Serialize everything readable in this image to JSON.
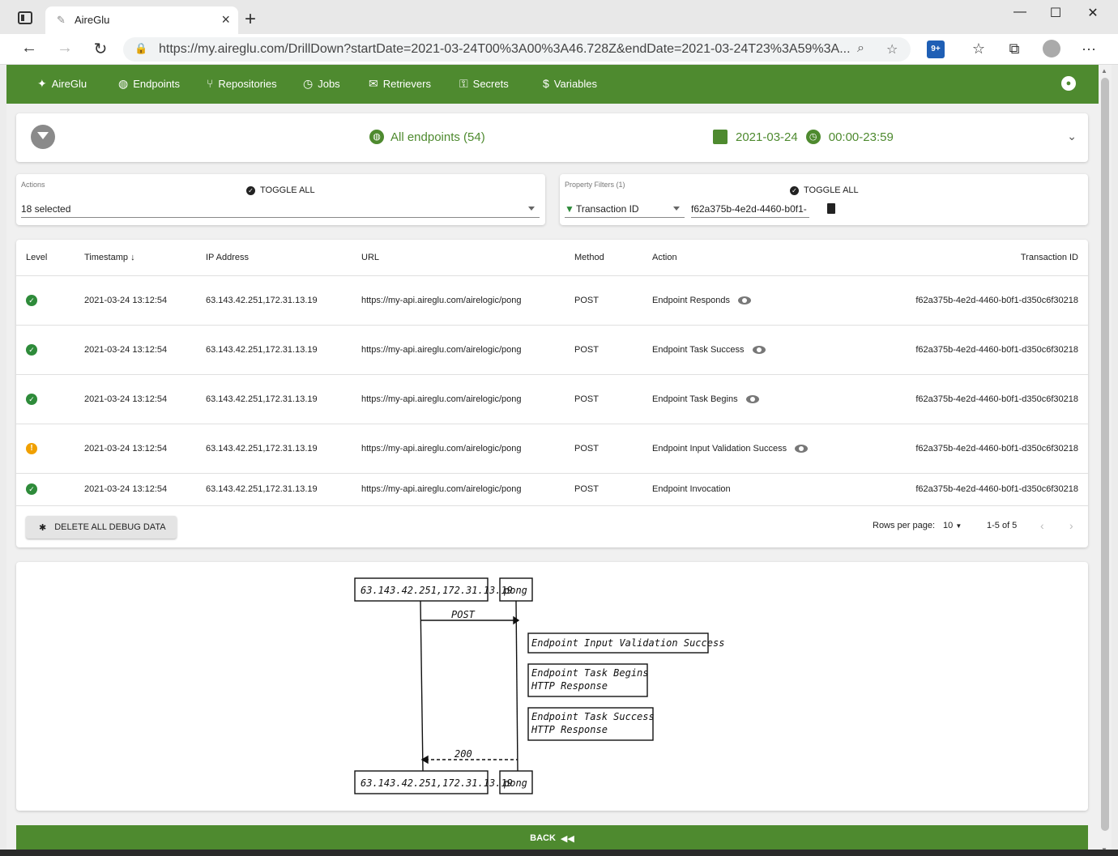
{
  "browser": {
    "tab_title": "AireGlu",
    "url": "https://my.aireglu.com/DrillDown?startDate=2021-03-24T00%3A00%3A46.728Z&endDate=2021-03-24T23%3A59%3A...",
    "extension_badge": "9+"
  },
  "nav": {
    "brand": "AireGlu",
    "items": [
      {
        "label": "Endpoints",
        "icon": "globe-icon"
      },
      {
        "label": "Repositories",
        "icon": "branch-icon"
      },
      {
        "label": "Jobs",
        "icon": "clock-icon"
      },
      {
        "label": "Retrievers",
        "icon": "envelope-icon"
      },
      {
        "label": "Secrets",
        "icon": "key-icon"
      },
      {
        "label": "Variables",
        "icon": "dollar-icon"
      }
    ]
  },
  "summary": {
    "endpoints_label": "All endpoints (54)",
    "date": "2021-03-24",
    "time_range": "00:00-23:59"
  },
  "actions_filter": {
    "label": "Actions",
    "toggle_all": "TOGGLE ALL",
    "selected": "18 selected"
  },
  "property_filters": {
    "label": "Property Filters (1)",
    "toggle_all": "TOGGLE ALL",
    "field": "Transaction ID",
    "value": "f62a375b-4e2d-4460-b0f1-"
  },
  "table": {
    "headers": {
      "level": "Level",
      "timestamp": "Timestamp",
      "ip": "IP Address",
      "url": "URL",
      "method": "Method",
      "action": "Action",
      "transaction_id": "Transaction ID"
    },
    "rows": [
      {
        "level": "success",
        "timestamp": "2021-03-24 13:12:54",
        "ip": "63.143.42.251,172.31.13.19",
        "url": "https://my-api.aireglu.com/airelogic/pong",
        "method": "POST",
        "action": "Endpoint Responds",
        "transaction_id": "f62a375b-4e2d-4460-b0f1-d350c6f30218"
      },
      {
        "level": "success",
        "timestamp": "2021-03-24 13:12:54",
        "ip": "63.143.42.251,172.31.13.19",
        "url": "https://my-api.aireglu.com/airelogic/pong",
        "method": "POST",
        "action": "Endpoint Task Success",
        "transaction_id": "f62a375b-4e2d-4460-b0f1-d350c6f30218"
      },
      {
        "level": "success",
        "timestamp": "2021-03-24 13:12:54",
        "ip": "63.143.42.251,172.31.13.19",
        "url": "https://my-api.aireglu.com/airelogic/pong",
        "method": "POST",
        "action": "Endpoint Task Begins",
        "transaction_id": "f62a375b-4e2d-4460-b0f1-d350c6f30218"
      },
      {
        "level": "warning",
        "timestamp": "2021-03-24 13:12:54",
        "ip": "63.143.42.251,172.31.13.19",
        "url": "https://my-api.aireglu.com/airelogic/pong",
        "method": "POST",
        "action": "Endpoint Input Validation Success",
        "transaction_id": "f62a375b-4e2d-4460-b0f1-d350c6f30218"
      },
      {
        "level": "success",
        "timestamp": "2021-03-24 13:12:54",
        "ip": "63.143.42.251,172.31.13.19",
        "url": "https://my-api.aireglu.com/airelogic/pong",
        "method": "POST",
        "action": "Endpoint Invocation",
        "transaction_id": "f62a375b-4e2d-4460-b0f1-d350c6f30218"
      }
    ],
    "delete_label": "DELETE ALL DEBUG DATA",
    "rows_per_page_label": "Rows per page:",
    "rows_per_page": "10",
    "page_range": "1-5 of 5"
  },
  "diagram": {
    "client": "63.143.42.251,172.31.13.19",
    "server": "pong",
    "request": "POST",
    "response": "200",
    "notes": [
      [
        "Endpoint Input Validation Success"
      ],
      [
        "Endpoint Task Begins",
        "HTTP Response"
      ],
      [
        "Endpoint Task Success",
        "HTTP Response"
      ]
    ]
  },
  "back_label": "BACK"
}
